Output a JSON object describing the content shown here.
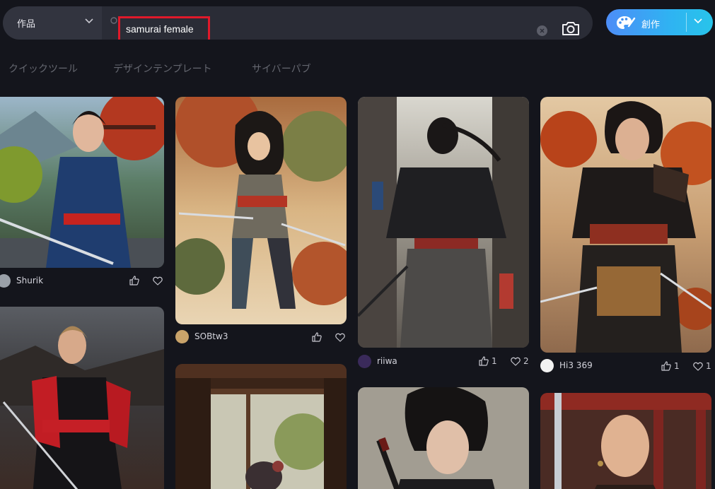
{
  "search": {
    "category": "作品",
    "query": "samurai female"
  },
  "create_button": {
    "label": "創作"
  },
  "tools_row": [
    "クイックツール",
    "デザインテンプレート",
    "サイバーパブ"
  ],
  "cards": [
    {
      "author": "Shurik",
      "likes": "",
      "favorites": ""
    },
    {
      "author": "SOBtw3",
      "likes": "",
      "favorites": ""
    },
    {
      "author": "riiwa",
      "likes": "1",
      "favorites": "2"
    },
    {
      "author": "Hi3 369",
      "likes": "1",
      "favorites": "1"
    }
  ],
  "colors": {
    "accent_start": "#4d8df7",
    "accent_end": "#28c4ea",
    "highlight": "#e0192a",
    "background": "#14151c"
  }
}
